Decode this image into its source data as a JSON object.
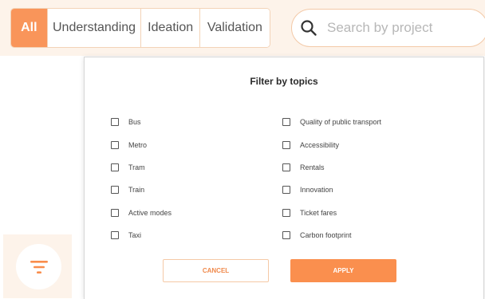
{
  "tabs": [
    {
      "label": "All",
      "active": true
    },
    {
      "label": "Understanding",
      "active": false
    },
    {
      "label": "Ideation",
      "active": false
    },
    {
      "label": "Validation",
      "active": false
    }
  ],
  "search": {
    "placeholder": "Search by project",
    "icon": "search-icon"
  },
  "filter_dialog": {
    "title": "Filter by topics",
    "left_options": [
      {
        "label": "Bus",
        "checked": false
      },
      {
        "label": "Metro",
        "checked": false
      },
      {
        "label": "Tram",
        "checked": false
      },
      {
        "label": "Train",
        "checked": false
      },
      {
        "label": "Active modes",
        "checked": false
      },
      {
        "label": "Taxi",
        "checked": false
      }
    ],
    "right_options": [
      {
        "label": "Quality of public transport",
        "checked": false
      },
      {
        "label": "Accessibility",
        "checked": false
      },
      {
        "label": "Rentals",
        "checked": false
      },
      {
        "label": "Innovation",
        "checked": false
      },
      {
        "label": "Ticket fares",
        "checked": false
      },
      {
        "label": "Carbon footprint",
        "checked": false
      }
    ],
    "cancel_label": "CANCEL",
    "apply_label": "APPLY"
  },
  "filter_button": {
    "icon": "filter-icon"
  },
  "colors": {
    "accent": "#fa8f4e",
    "background_tint": "#fdf3ea"
  }
}
